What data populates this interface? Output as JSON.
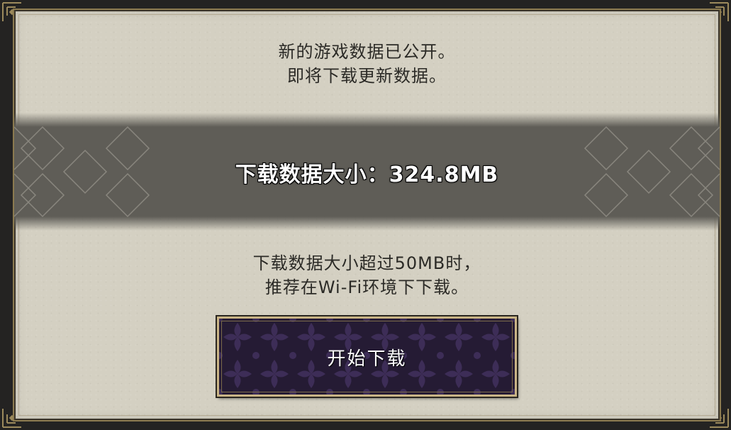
{
  "dialog": {
    "intro_line1": "新的游戏数据已公开。",
    "intro_line2": "即将下载更新数据。",
    "size_label": "下载数据大小：324.8MB",
    "warning_line1": "下载数据大小超过50MB时，",
    "warning_line2": "推荐在Wi-Fi环境下下载。",
    "download_button_label": "开始下载"
  },
  "colors": {
    "panel": "#d4d0c2",
    "band": "#5f5d57",
    "button_bg": "#2a1f3a",
    "button_border": "#c9b486",
    "frame": "#242322"
  }
}
